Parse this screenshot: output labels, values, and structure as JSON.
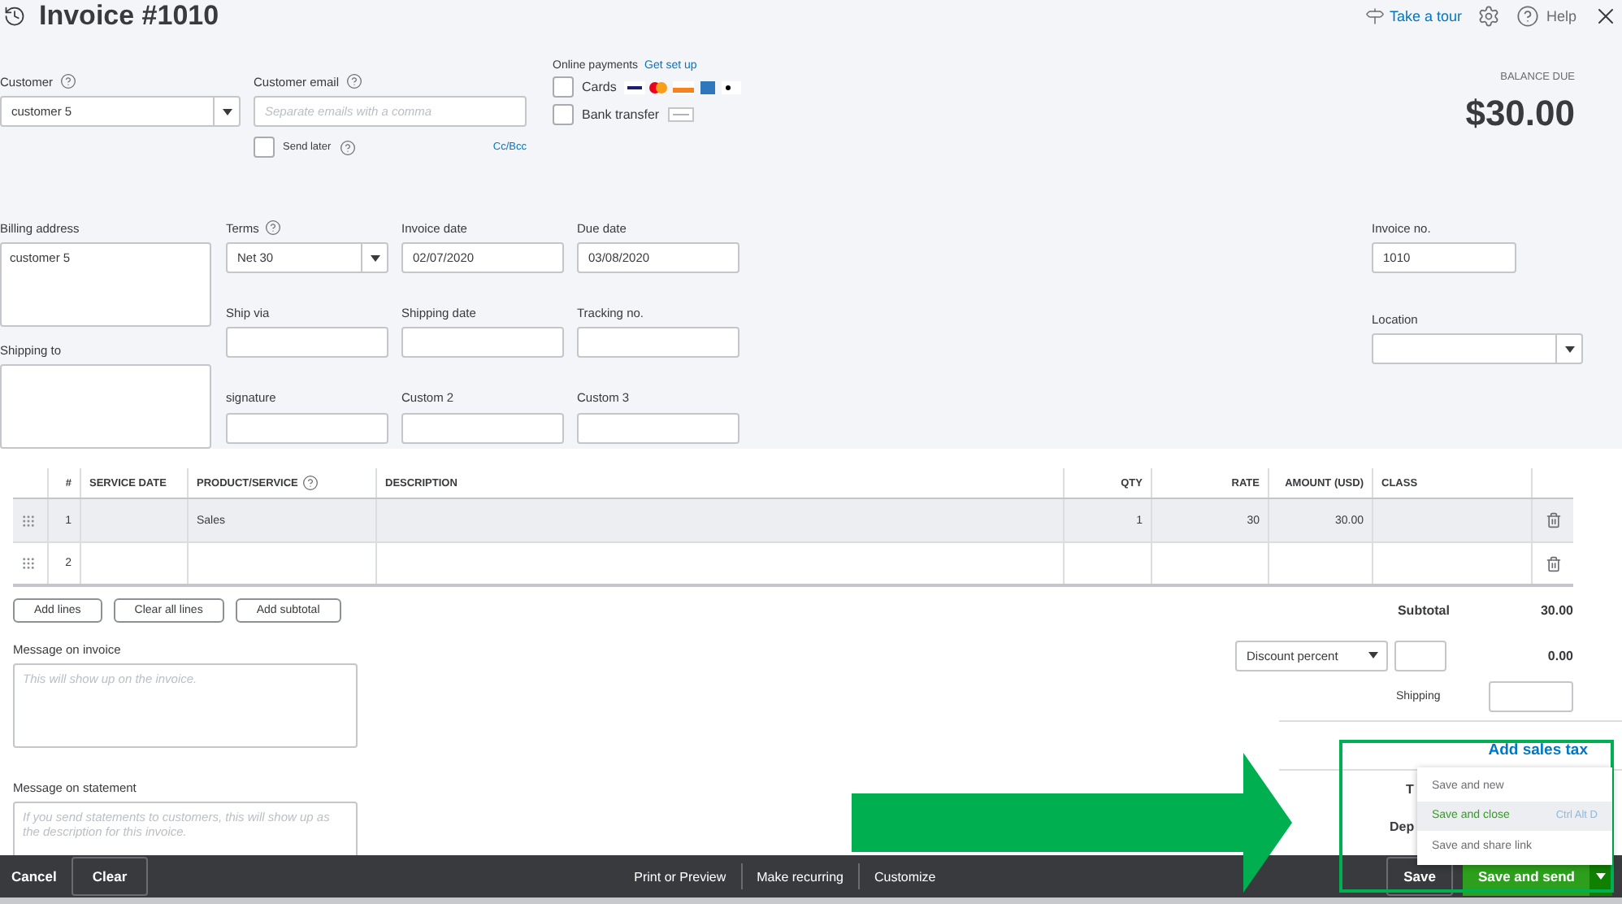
{
  "header": {
    "title": "Invoice #1010",
    "tour": "Take a tour",
    "help": "Help"
  },
  "customer": {
    "label": "Customer",
    "help": true,
    "value": "customer 5"
  },
  "email": {
    "label": "Customer email",
    "help": true,
    "placeholder": "Separate emails with a comma",
    "cc_bcc": "Cc/Bcc"
  },
  "send_later": {
    "label": "Send later",
    "help": true,
    "checked": false
  },
  "online_payments": {
    "label": "Online payments",
    "link": "Get set up",
    "options": [
      {
        "label": "Cards",
        "kind": "cards",
        "checked": false
      },
      {
        "label": "Bank transfer",
        "kind": "bank",
        "checked": false
      }
    ]
  },
  "balance": {
    "label": "BALANCE DUE",
    "amount": "$30.00"
  },
  "billing_address": {
    "label": "Billing address",
    "value": "customer 5"
  },
  "shipping_to": {
    "label": "Shipping to"
  },
  "fields": [
    {
      "label": "Terms",
      "help": true,
      "kind": "select",
      "value": "Net 30"
    },
    {
      "label": "Invoice date",
      "help": false,
      "kind": "text",
      "value": "02/07/2020"
    },
    {
      "label": "Due date",
      "help": false,
      "kind": "text",
      "value": "03/08/2020"
    },
    {
      "label": "Ship via",
      "help": false,
      "kind": "text"
    },
    {
      "label": "Shipping date",
      "help": false,
      "kind": "text"
    },
    {
      "label": "Tracking no.",
      "help": false,
      "kind": "text"
    },
    {
      "label": "signature",
      "help": false,
      "kind": "text"
    },
    {
      "label": "Custom 2",
      "help": false,
      "kind": "text"
    },
    {
      "label": "Custom 3",
      "help": false,
      "kind": "text"
    }
  ],
  "invoice_no": {
    "label": "Invoice no.",
    "value": "1010"
  },
  "location": {
    "label": "Location"
  },
  "table": {
    "columns": [
      {
        "label": "#",
        "help": false
      },
      {
        "label": "SERVICE DATE",
        "help": false
      },
      {
        "label": "PRODUCT/SERVICE",
        "help": true
      },
      {
        "label": "DESCRIPTION",
        "help": false
      },
      {
        "label": "QTY",
        "help": false
      },
      {
        "label": "RATE",
        "help": false
      },
      {
        "label": "AMOUNT (USD)",
        "help": false
      },
      {
        "label": "CLASS",
        "help": false
      }
    ],
    "rows": [
      {
        "number": "1",
        "product": "Sales",
        "qty": "1",
        "rate": "30",
        "amount": "30.00",
        "selected": true
      },
      {
        "number": "2",
        "selected": false
      }
    ]
  },
  "table_buttons": [
    "Add lines",
    "Clear all lines",
    "Add subtotal"
  ],
  "subtotal": {
    "label": "Subtotal",
    "value": "30.00"
  },
  "discount": {
    "type": "Discount percent",
    "value": "0.00"
  },
  "shipping": {
    "label": "Shipping"
  },
  "add_sales_tax": "Add sales tax",
  "hidden_totals": [
    "T",
    "Dep"
  ],
  "messages": [
    {
      "label": "Message on invoice",
      "placeholder": "This will show up on the invoice."
    },
    {
      "label": "Message on statement",
      "placeholder": "If you send statements to customers, this will show up as the description for this invoice."
    }
  ],
  "footer": {
    "left": [
      "Cancel",
      "Clear"
    ],
    "center": [
      "Print or Preview",
      "Make recurring",
      "Customize"
    ],
    "save": "Save",
    "save_and_send": "Save and send"
  },
  "save_menu": [
    {
      "label": "Save and new",
      "selected": false
    },
    {
      "label": "Save and close",
      "shortcut": "Ctrl Alt D",
      "selected": true
    },
    {
      "label": "Save and share link",
      "selected": false
    }
  ]
}
